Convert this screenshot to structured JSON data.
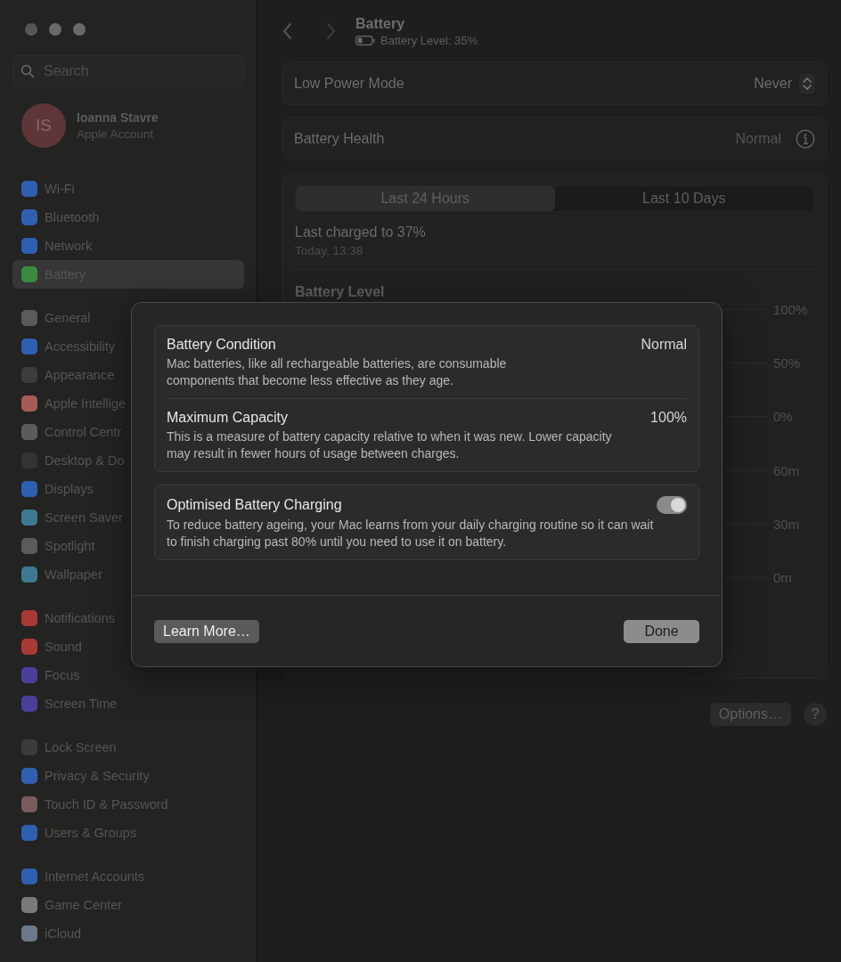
{
  "sidebar": {
    "search": {
      "placeholder": "Search"
    },
    "account": {
      "initials": "IS",
      "name": "Ioanna Stavre",
      "subtitle": "Apple Account"
    },
    "groups": [
      [
        {
          "label": "Wi-Fi",
          "color": "#2f5fb0",
          "selected": false
        },
        {
          "label": "Bluetooth",
          "color": "#2f5fb0",
          "selected": false
        },
        {
          "label": "Network",
          "color": "#2f5fb0",
          "selected": false
        },
        {
          "label": "Battery",
          "color": "#3a8a3f",
          "selected": true
        }
      ],
      [
        {
          "label": "General",
          "color": "#5b5b5b",
          "selected": false
        },
        {
          "label": "Accessibility",
          "color": "#2f5fb0",
          "selected": false
        },
        {
          "label": "Appearance",
          "color": "#3c3c3c",
          "selected": false
        },
        {
          "label": "Apple Intellige",
          "color": "#a85a55",
          "selected": false
        },
        {
          "label": "Control Centr",
          "color": "#5b5b5b",
          "selected": false
        },
        {
          "label": "Desktop & Do",
          "color": "#333333",
          "selected": false
        },
        {
          "label": "Displays",
          "color": "#2f5fb0",
          "selected": false
        },
        {
          "label": "Screen Saver",
          "color": "#3d7a92",
          "selected": false
        },
        {
          "label": "Spotlight",
          "color": "#5b5b5b",
          "selected": false
        },
        {
          "label": "Wallpaper",
          "color": "#3d7a92",
          "selected": false
        }
      ],
      [
        {
          "label": "Notifications",
          "color": "#a83a35",
          "selected": false
        },
        {
          "label": "Sound",
          "color": "#a83a35",
          "selected": false
        },
        {
          "label": "Focus",
          "color": "#4a3f9a",
          "selected": false
        },
        {
          "label": "Screen Time",
          "color": "#4a3f9a",
          "selected": false
        }
      ],
      [
        {
          "label": "Lock Screen",
          "color": "#3a3a3a",
          "selected": false
        },
        {
          "label": "Privacy & Security",
          "color": "#2f5fb0",
          "selected": false
        },
        {
          "label": "Touch ID & Password",
          "color": "#7a5a5a",
          "selected": false
        },
        {
          "label": "Users & Groups",
          "color": "#2f5fb0",
          "selected": false
        }
      ],
      [
        {
          "label": "Internet Accounts",
          "color": "#2f5fb0",
          "selected": false
        },
        {
          "label": "Game Center",
          "color": "#7a7a7a",
          "selected": false
        },
        {
          "label": "iCloud",
          "color": "#6a7a8a",
          "selected": false
        }
      ]
    ]
  },
  "header": {
    "title": "Battery",
    "subtitle": "Battery Level: 35%"
  },
  "settings": [
    {
      "kind": "popup",
      "label": "Low Power Mode",
      "value": "Never"
    },
    {
      "kind": "info",
      "label": "Battery Health",
      "value": "Normal"
    }
  ],
  "usage": {
    "tabs": [
      {
        "label": "Last 24 Hours",
        "selected": true
      },
      {
        "label": "Last 10 Days",
        "selected": false
      }
    ],
    "last_charged": "Last charged to 37%",
    "time": "Today, 13:38",
    "section_title": "Battery Level",
    "level_ticks": [
      "100%",
      "50%",
      "0%"
    ],
    "screen_ticks": [
      "60m",
      "30m",
      "0m"
    ]
  },
  "options_button": "Options…",
  "help_button": "?",
  "dialog": {
    "items": [
      {
        "kind": "text",
        "title": "Battery Condition",
        "value": "Normal",
        "description": "Mac batteries, like all rechargeable batteries, are consumable components that become less effective as they age."
      },
      {
        "kind": "text",
        "title": "Maximum Capacity",
        "value": "100%",
        "description": "This is a measure of battery capacity relative to when it was new. Lower capacity may result in fewer hours of usage between charges."
      }
    ],
    "toggle": {
      "title": "Optimised Battery Charging",
      "on": true,
      "description": "To reduce battery ageing, your Mac learns from your daily charging routine so it can wait to finish charging past 80% until you need to use it on battery."
    },
    "buttons": [
      {
        "label": "Learn More…",
        "kind": "secondary"
      },
      {
        "label": "Done",
        "kind": "primary"
      }
    ]
  }
}
